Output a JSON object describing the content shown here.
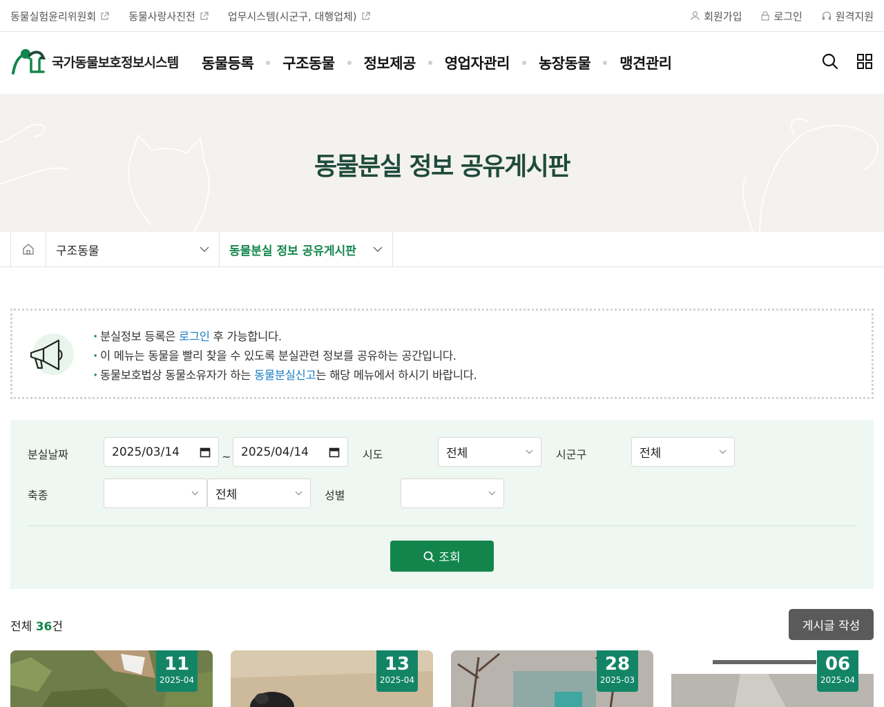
{
  "util_bar": {
    "left_links": [
      "동물실험윤리위원회",
      "동물사랑사진전",
      "업무시스템(시군구, 대행업체)"
    ],
    "right_items": {
      "signup": "회원가입",
      "login": "로그인",
      "remote": "원격지원"
    }
  },
  "header": {
    "logo_text": "국가동물보호정보시스템",
    "menu": [
      "동물등록",
      "구조동물",
      "정보제공",
      "영업자관리",
      "농장동물",
      "맹견관리"
    ],
    "tools": [
      "search-icon",
      "all-menu-icon"
    ]
  },
  "hero": {
    "title": "동물분실 정보 공유게시판"
  },
  "breadcrumb": {
    "level1": "구조동물",
    "level2": "동물분실 정보 공유게시판"
  },
  "notice": {
    "line1": {
      "before": "분실정보 등록은 ",
      "link": "로그인",
      "after": " 후 가능합니다."
    },
    "line2": "이 메뉴는 동물을 빨리 찾을 수 있도록 분실관련 정보를 공유하는 공간입니다.",
    "line3": {
      "before": "동물보호법상 동물소유자가 하는 ",
      "link": "동물분실신고",
      "after": "는 해당 메뉴에서 하시기 바랍니다."
    },
    "bullet": "·"
  },
  "search": {
    "lost_date_label": "분실날짜",
    "date_from": "2025/03/14",
    "date_to": "2025/04/14",
    "tilde": "~",
    "sido_label": "시도",
    "sido_value": "전체",
    "sigungu_label": "시군구",
    "sigungu_value": "전체",
    "species_label": "축종",
    "species_value": "",
    "breed_value": "전체",
    "gender_label": "성별",
    "gender_value": "",
    "search_button": "조회"
  },
  "list": {
    "total_prefix": "전체",
    "total_count": "36",
    "total_suffix": "건",
    "write_button": "게시글 작성",
    "cards": [
      {
        "day": "11",
        "ym": "2025-04"
      },
      {
        "day": "13",
        "ym": "2025-04"
      },
      {
        "day": "28",
        "ym": "2025-03"
      },
      {
        "day": "06",
        "ym": "2025-04"
      }
    ]
  },
  "colors": {
    "brand_green": "#13854c",
    "hero_title": "#1e4a3c",
    "badge_teal": "#138566",
    "link_blue": "#1a7cc7",
    "search_bg": "#eef7f1"
  }
}
